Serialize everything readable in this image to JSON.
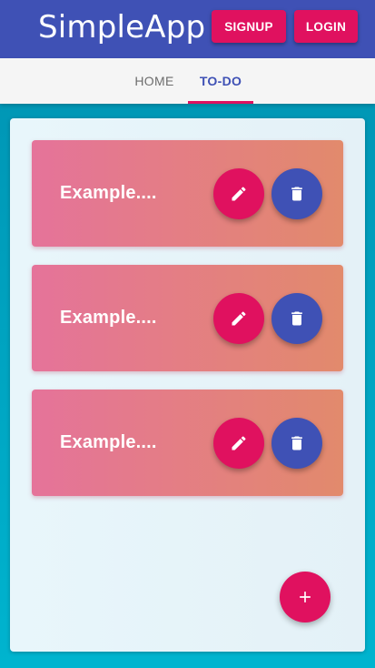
{
  "header": {
    "title": "SimpleApp",
    "signup_label": "SIGNUP",
    "login_label": "LOGIN"
  },
  "tabs": [
    {
      "label": "HOME",
      "active": false
    },
    {
      "label": "TO-DO",
      "active": true
    }
  ],
  "todos": [
    {
      "text": "Example....",
      "edit_icon": "pencil-icon",
      "delete_icon": "trash-icon"
    },
    {
      "text": "Example....",
      "edit_icon": "pencil-icon",
      "delete_icon": "trash-icon"
    },
    {
      "text": "Example....",
      "edit_icon": "pencil-icon",
      "delete_icon": "trash-icon"
    }
  ],
  "add_button": {
    "icon": "plus-icon"
  },
  "colors": {
    "primary": "#3f51b5",
    "accent": "#e0115f",
    "background": "#00a7c4",
    "card_gradient_start": "#e5739a",
    "card_gradient_end": "#e28a6c"
  }
}
